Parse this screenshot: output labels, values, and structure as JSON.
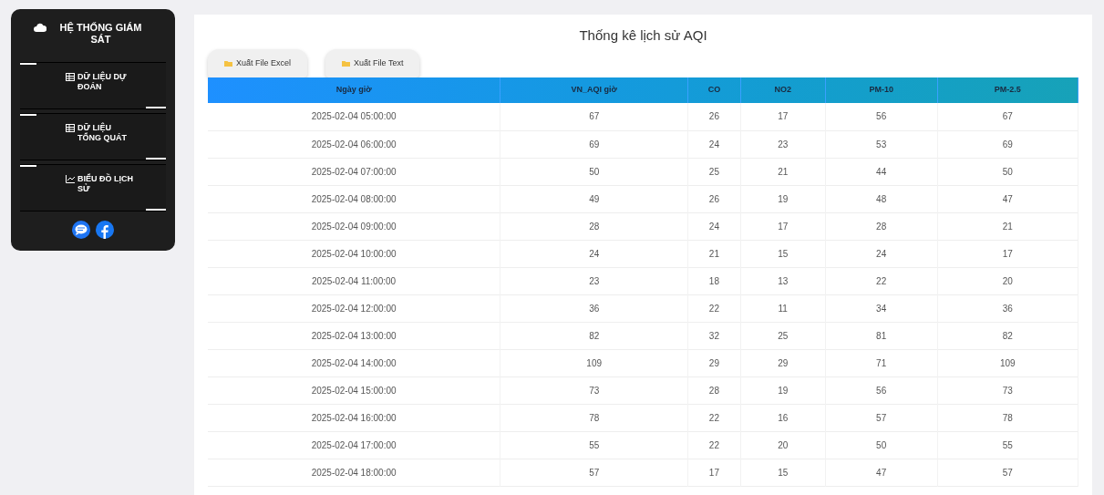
{
  "sidebar": {
    "title": "HỆ THỐNG GIÁM SÁT",
    "items": [
      {
        "label": "DỮ LIỆU DỰ ĐOÁN",
        "kind": "table"
      },
      {
        "label": "DỮ LIỆU TỔNG QUÁT",
        "kind": "table"
      },
      {
        "label": "BIỂU ĐỒ LỊCH SỬ",
        "kind": "chart"
      }
    ],
    "social": [
      {
        "kind": "zalo"
      },
      {
        "kind": "facebook"
      }
    ]
  },
  "title": "Thống kê lịch sử AQI",
  "buttons": [
    "Xuất File Excel",
    "Xuất File Text"
  ],
  "table": {
    "columns": [
      "Ngày giờ",
      "VN_AQI giờ",
      "CO",
      "NO2",
      "PM-10",
      "PM-2.5"
    ],
    "rows": [
      [
        "2025-02-04 05:00:00",
        "67",
        "26",
        "17",
        "56",
        "67"
      ],
      [
        "2025-02-04 06:00:00",
        "69",
        "24",
        "23",
        "53",
        "69"
      ],
      [
        "2025-02-04 07:00:00",
        "50",
        "25",
        "21",
        "44",
        "50"
      ],
      [
        "2025-02-04 08:00:00",
        "49",
        "26",
        "19",
        "48",
        "47"
      ],
      [
        "2025-02-04 09:00:00",
        "28",
        "24",
        "17",
        "28",
        "21"
      ],
      [
        "2025-02-04 10:00:00",
        "24",
        "21",
        "15",
        "24",
        "17"
      ],
      [
        "2025-02-04 11:00:00",
        "23",
        "18",
        "13",
        "22",
        "20"
      ],
      [
        "2025-02-04 12:00:00",
        "36",
        "22",
        "11",
        "34",
        "36"
      ],
      [
        "2025-02-04 13:00:00",
        "82",
        "32",
        "25",
        "81",
        "82"
      ],
      [
        "2025-02-04 14:00:00",
        "109",
        "29",
        "29",
        "71",
        "109"
      ],
      [
        "2025-02-04 15:00:00",
        "73",
        "28",
        "19",
        "56",
        "73"
      ],
      [
        "2025-02-04 16:00:00",
        "78",
        "22",
        "16",
        "57",
        "78"
      ],
      [
        "2025-02-04 17:00:00",
        "55",
        "22",
        "20",
        "50",
        "55"
      ],
      [
        "2025-02-04 18:00:00",
        "57",
        "17",
        "15",
        "47",
        "57"
      ]
    ]
  }
}
